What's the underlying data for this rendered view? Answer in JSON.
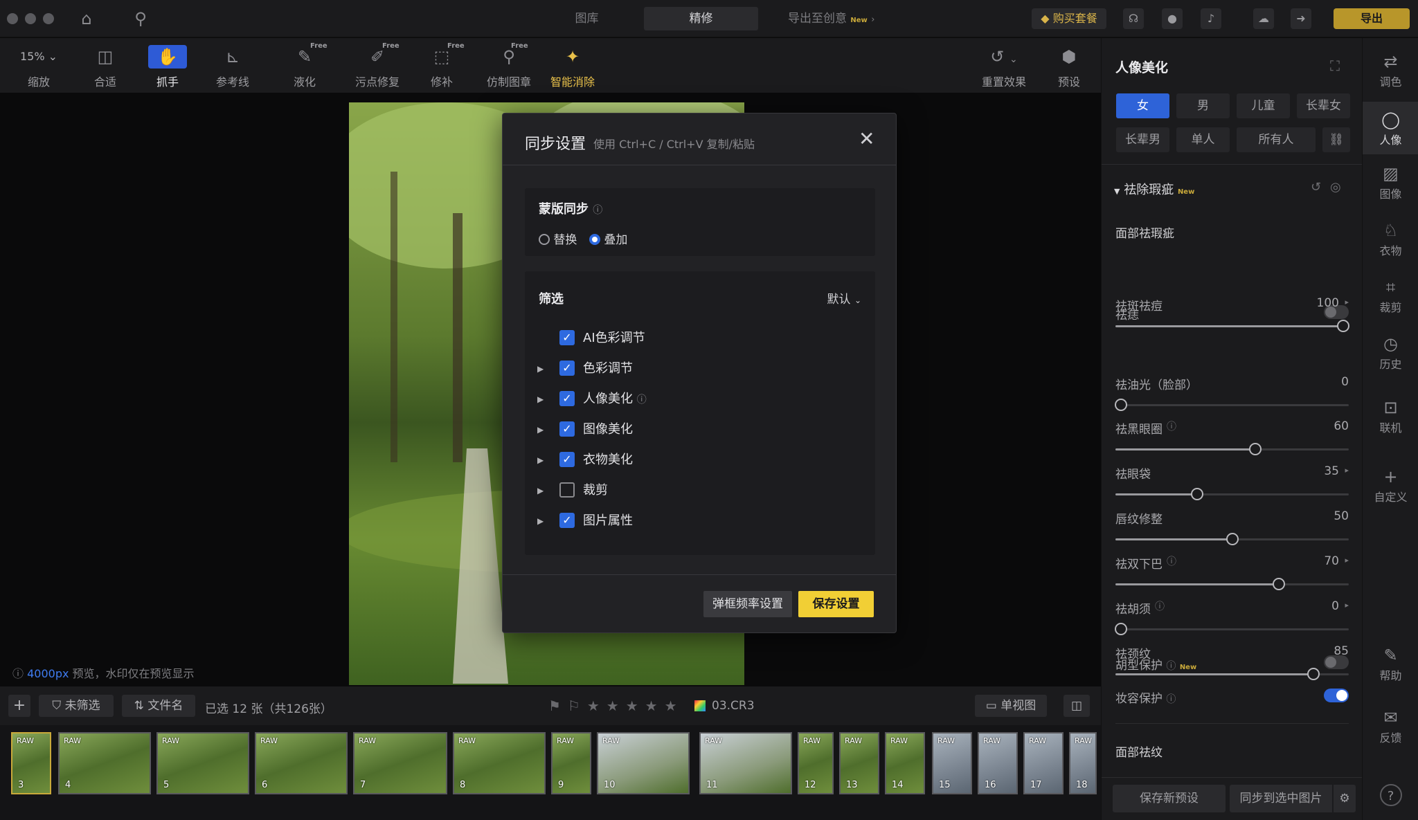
{
  "titlebar": {
    "tabs": [
      "图库",
      "精修"
    ],
    "active_tab": "精修",
    "export_to": "导出至创意",
    "export_badge": "New",
    "buy": "购买套餐",
    "export_btn": "导出"
  },
  "toolbar": {
    "zoom": "15%",
    "items": [
      {
        "label": "缩放"
      },
      {
        "label": "合适"
      },
      {
        "label": "抓手"
      },
      {
        "label": "参考线"
      },
      {
        "label": "液化",
        "badge": "Free"
      },
      {
        "label": "污点修复",
        "badge": "Free"
      },
      {
        "label": "修补",
        "badge": "Free"
      },
      {
        "label": "仿制图章",
        "badge": "Free"
      },
      {
        "label": "智能消除"
      }
    ],
    "reset": "重置效果",
    "preset": "预设"
  },
  "canvas": {
    "preview_size": "4000px",
    "preview_note": "预览，水印仅在预览显示"
  },
  "modal": {
    "title": "同步设置",
    "hint": "使用 Ctrl+C / Ctrl+V 复制/粘贴",
    "mask_title": "蒙版同步",
    "mask_options": [
      "替换",
      "叠加"
    ],
    "mask_selected": "叠加",
    "filter_title": "筛选",
    "filter_default": "默认",
    "items": [
      {
        "label": "AI色彩调节",
        "checked": true,
        "expandable": false
      },
      {
        "label": "色彩调节",
        "checked": true,
        "expandable": true
      },
      {
        "label": "人像美化",
        "checked": true,
        "expandable": true,
        "help": true
      },
      {
        "label": "图像美化",
        "checked": true,
        "expandable": true
      },
      {
        "label": "衣物美化",
        "checked": true,
        "expandable": true
      },
      {
        "label": "裁剪",
        "checked": false,
        "expandable": true
      },
      {
        "label": "图片属性",
        "checked": true,
        "expandable": true
      }
    ],
    "btn_freq": "弹框频率设置",
    "btn_save": "保存设置"
  },
  "panel": {
    "title": "人像美化",
    "chips": [
      "女",
      "男",
      "儿童",
      "长辈女",
      "长辈男",
      "单人",
      "所有人"
    ],
    "active_chip": "女",
    "section": "祛除瑕疵",
    "section_badge": "New",
    "subsection": "面部祛瑕疵",
    "sliders": [
      {
        "label": "祛斑祛痘",
        "value": 100,
        "max": 100,
        "arrow": true
      },
      {
        "label": "祛油光（脸部）",
        "value": 0,
        "max": 100,
        "arrow": false
      },
      {
        "label": "祛黑眼圈",
        "value": 60,
        "max": 100,
        "arrow": false,
        "help": true
      },
      {
        "label": "祛眼袋",
        "value": 35,
        "max": 100,
        "arrow": true
      },
      {
        "label": "唇纹修整",
        "value": 50,
        "max": 100,
        "arrow": false
      },
      {
        "label": "祛双下巴",
        "value": 70,
        "max": 100,
        "arrow": true,
        "help": true
      },
      {
        "label": "祛胡须",
        "value": 0,
        "max": 100,
        "arrow": true,
        "help": true
      },
      {
        "label": "祛颈纹",
        "value": 85,
        "max": 100,
        "arrow": false
      }
    ],
    "toggle_acne": "祛痣",
    "beard_protect": "胡型保护",
    "beard_badge": "New",
    "makeup_protect": "妆容保护",
    "section2": "面部祛纹",
    "save_preset": "保存新预设",
    "sync_selected": "同步到选中图片"
  },
  "strip": [
    {
      "label": "调色",
      "icon": "sliders-icon"
    },
    {
      "label": "人像",
      "icon": "face-icon"
    },
    {
      "label": "图像",
      "icon": "image-icon"
    },
    {
      "label": "衣物",
      "icon": "shirt-icon"
    },
    {
      "label": "裁剪",
      "icon": "crop-icon"
    },
    {
      "label": "历史",
      "icon": "history-icon"
    },
    {
      "label": "联机",
      "icon": "tether-icon"
    },
    {
      "label": "自定义",
      "icon": "plus-icon"
    },
    {
      "label": "帮助",
      "icon": "help-icon"
    },
    {
      "label": "反馈",
      "icon": "feedback-icon"
    }
  ],
  "filmbar": {
    "unfiltered": "未筛选",
    "sort": "文件名",
    "selected": "已选 12 张（共126张）",
    "filename": "03.CR3",
    "single_view": "单视图"
  },
  "thumbs": [
    {
      "tag": "RAW",
      "num": "3"
    },
    {
      "tag": "RAW",
      "num": "4"
    },
    {
      "tag": "RAW",
      "num": "5"
    },
    {
      "tag": "RAW",
      "num": "6"
    },
    {
      "tag": "RAW",
      "num": "7"
    },
    {
      "tag": "RAW",
      "num": "8"
    },
    {
      "tag": "RAW",
      "num": "9"
    },
    {
      "tag": "RAW",
      "num": "10"
    },
    {
      "tag": "RAW",
      "num": "11"
    },
    {
      "tag": "RAW",
      "num": "12"
    },
    {
      "tag": "RAW",
      "num": "13"
    },
    {
      "tag": "RAW",
      "num": "14"
    },
    {
      "tag": "RAW",
      "num": "15"
    },
    {
      "tag": "RAW",
      "num": "16"
    },
    {
      "tag": "RAW",
      "num": "17"
    },
    {
      "tag": "RAW",
      "num": "18"
    }
  ]
}
